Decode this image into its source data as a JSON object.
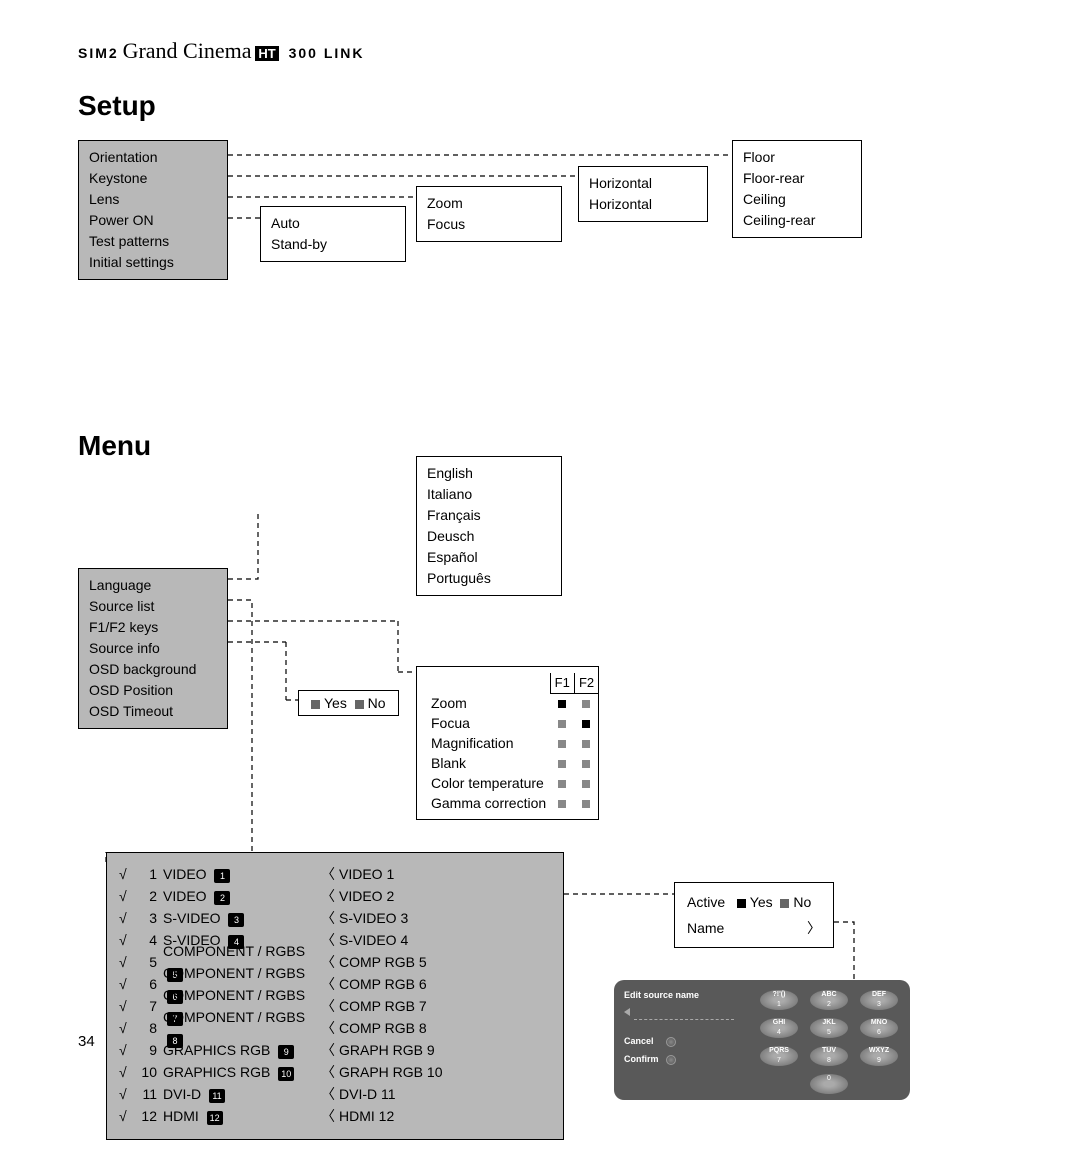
{
  "header": {
    "brand_sim2": "SIM2",
    "brand_cursive": "Grand Cinema",
    "ht": "HT",
    "link": "300 LINK"
  },
  "setup": {
    "title": "Setup",
    "main": [
      "Orientation",
      "Keystone",
      "Lens",
      "Power ON",
      "Test patterns",
      "Initial settings"
    ],
    "power": [
      "Auto",
      "Stand-by"
    ],
    "lens": [
      "Zoom",
      "Focus"
    ],
    "keystone": [
      "Horizontal",
      "Horizontal"
    ],
    "orientation": [
      "Floor",
      "Floor-rear",
      "Ceiling",
      "Ceiling-rear"
    ]
  },
  "menu": {
    "title": "Menu",
    "main": [
      "Language",
      "Source list",
      "F1/F2 keys",
      "Source info",
      "OSD background",
      "OSD Position",
      "OSD Timeout"
    ],
    "langs": [
      "English",
      "Italiano",
      "Français",
      "Deusch",
      "Español",
      "Português"
    ],
    "yesno": {
      "yes": "Yes",
      "no": "No"
    },
    "f1f2": {
      "h1": "F1",
      "h2": "F2",
      "rows": [
        {
          "label": "Zoom",
          "f1": "k",
          "f2": "d"
        },
        {
          "label": "Focua",
          "f1": "d",
          "f2": "k"
        },
        {
          "label": "Magnification",
          "f1": "d",
          "f2": "d"
        },
        {
          "label": "Blank",
          "f1": "d",
          "f2": "d"
        },
        {
          "label": "Color temperature",
          "f1": "d",
          "f2": "d"
        },
        {
          "label": "Gamma correction",
          "f1": "d",
          "f2": "d"
        }
      ]
    },
    "sources": [
      {
        "n": "1",
        "name": "VIDEO",
        "b": "1",
        "right": "VIDEO 1"
      },
      {
        "n": "2",
        "name": "VIDEO",
        "b": "2",
        "right": "VIDEO 2"
      },
      {
        "n": "3",
        "name": "S-VIDEO",
        "b": "3",
        "right": "S-VIDEO 3"
      },
      {
        "n": "4",
        "name": "S-VIDEO",
        "b": "4",
        "right": "S-VIDEO 4"
      },
      {
        "n": "5",
        "name": "COMPONENT / RGBS",
        "b": "5",
        "right": "COMP RGB 5"
      },
      {
        "n": "6",
        "name": "COMPONENT / RGBS",
        "b": "6",
        "right": "COMP RGB 6"
      },
      {
        "n": "7",
        "name": "COMPONENT / RGBS",
        "b": "7",
        "right": "COMP RGB 7"
      },
      {
        "n": "8",
        "name": "COMPONENT / RGBS",
        "b": "8",
        "right": "COMP RGB 8"
      },
      {
        "n": "9",
        "name": "GRAPHICS RGB",
        "b": "9",
        "right": "GRAPH RGB 9"
      },
      {
        "n": "10",
        "name": "GRAPHICS RGB",
        "b": "10",
        "right": "GRAPH RGB 10"
      },
      {
        "n": "11",
        "name": "DVI-D",
        "b": "11",
        "right": "DVI-D 11"
      },
      {
        "n": "12",
        "name": "HDMI",
        "b": "12",
        "right": "HDMI 12"
      }
    ],
    "active": {
      "label": "Active",
      "yes": "Yes",
      "no": "No",
      "name": "Name"
    },
    "edit": {
      "title": "Edit source name",
      "cancel": "Cancel",
      "confirm": "Confirm",
      "keys": [
        {
          "t": "?!'()",
          "b": "1"
        },
        {
          "t": "ABC",
          "b": "2"
        },
        {
          "t": "DEF",
          "b": "3"
        },
        {
          "t": "GHI",
          "b": "4"
        },
        {
          "t": "JKL",
          "b": "5"
        },
        {
          "t": "MNO",
          "b": "6"
        },
        {
          "t": "PQRS",
          "b": "7"
        },
        {
          "t": "TUV",
          "b": "8"
        },
        {
          "t": "WXYZ",
          "b": "9"
        },
        {
          "t": "",
          "b": "0"
        }
      ]
    }
  },
  "page": "34"
}
